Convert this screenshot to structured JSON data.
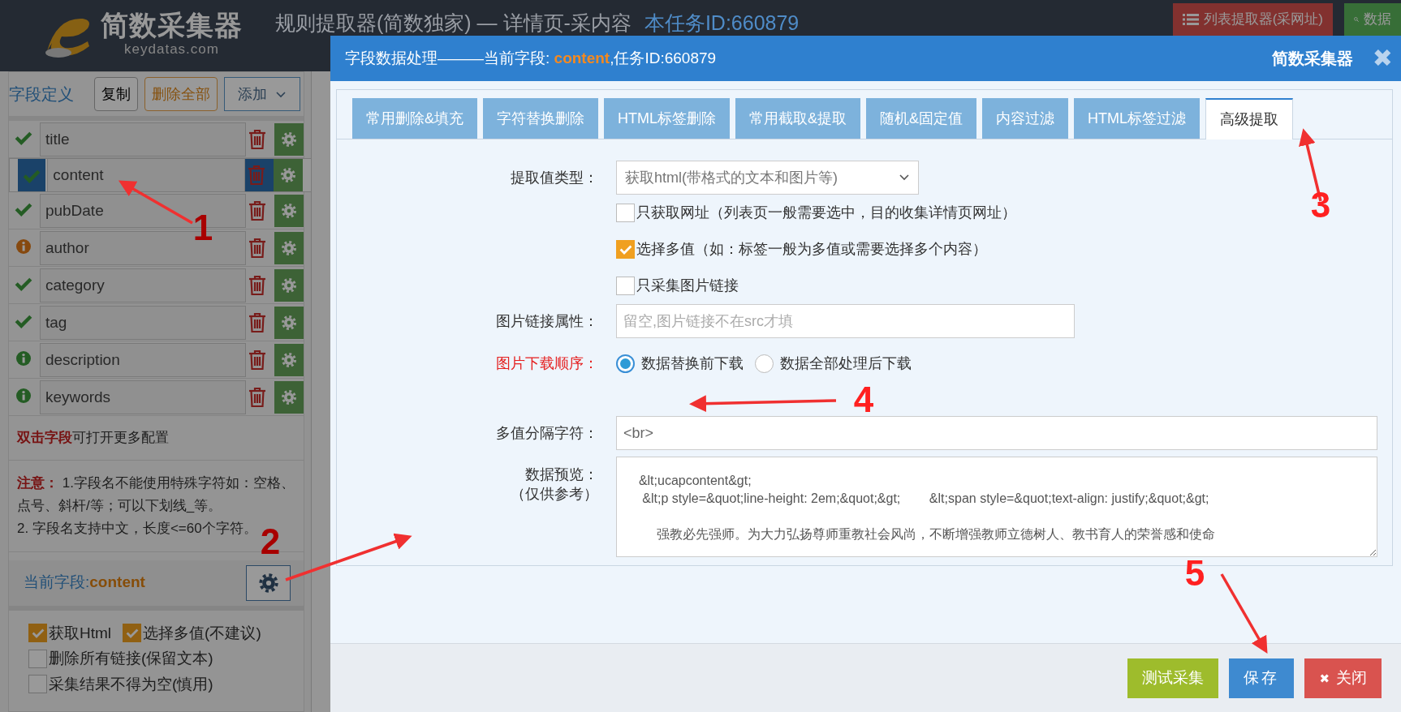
{
  "header": {
    "logo_text": "简数采集器",
    "logo_subtext": "keydatas.com",
    "title": "规则提取器(简数独家) — 详情页-采内容",
    "task_id": "本任务ID:660879",
    "buttons": [
      {
        "label": "列表提取器(采网址)",
        "kind": "list"
      },
      {
        "label": "数据",
        "kind": "preview"
      }
    ]
  },
  "fields_panel": {
    "title": "字段定义",
    "buttons": [
      {
        "label": "复制",
        "kind": "default"
      },
      {
        "label": "删除全部",
        "kind": "warning"
      },
      {
        "label": "添加",
        "kind": "dropdown"
      }
    ],
    "fields": [
      {
        "name": "title",
        "kind": "ok",
        "selected": false
      },
      {
        "name": "content",
        "kind": "ok",
        "selected": true
      },
      {
        "name": "pubDate",
        "kind": "ok",
        "selected": false
      },
      {
        "name": "author",
        "kind": "warning",
        "selected": false
      },
      {
        "name": "category",
        "kind": "ok",
        "selected": false
      },
      {
        "name": "tag",
        "kind": "ok",
        "selected": false
      },
      {
        "name": "description",
        "kind": "info",
        "selected": false
      },
      {
        "name": "keywords",
        "kind": "info",
        "selected": false
      }
    ],
    "hint": "**双击字段**可打开更多配置",
    "notes": [
      "**注意：** 1.字段名不能使用特殊字符如：空格、点号、斜杆/等；可以下划线_等。",
      "2. 字段名支持中文，长度<=60个字符。"
    ],
    "current_field": {
      "label": "当前字段:",
      "value": "content"
    },
    "options": [
      {
        "label": "获取Html",
        "checked": true
      },
      {
        "label": "选择多值(不建议)",
        "checked": true
      },
      {
        "label": "删除所有链接(保留文本)",
        "checked": false
      },
      {
        "label": "采集结果不得为空(慎用)",
        "checked": false
      }
    ]
  },
  "dialog": {
    "title": "字段数据处理———当前字段: **content**,任务ID:660879",
    "brand": "简数采集器",
    "close": "✖",
    "tabs": [
      {
        "label": "常用删除&填充",
        "selected": false
      },
      {
        "label": "字符替换删除",
        "selected": false
      },
      {
        "label": "HTML标签删除",
        "selected": false
      },
      {
        "label": "常用截取&提取",
        "selected": false
      },
      {
        "label": "随机&固定值",
        "selected": false
      },
      {
        "label": "内容过滤",
        "selected": false
      },
      {
        "label": "HTML标签过滤",
        "selected": false
      },
      {
        "label": "高级提取",
        "selected": true
      }
    ],
    "extract_type": {
      "label": "提取值类型：",
      "value": "获取html(带格式的文本和图片等)"
    },
    "checkboxes": [
      {
        "label": "只获取网址（列表页一般需要选中，目的收集详情页网址）",
        "checked": false
      },
      {
        "label": "选择多值（如：标签一般为多值或需要选择多个内容）",
        "checked": true
      },
      {
        "label": "只采集图片链接",
        "checked": false
      }
    ],
    "image_attr": {
      "label": "图片链接属性：",
      "placeholder": "留空,图片链接不在src才填"
    },
    "download_order": {
      "label": "图片下载顺序：",
      "options": [
        {
          "label": "数据替换前下载",
          "selected": true
        },
        {
          "label": "数据全部处理后下载",
          "selected": false
        }
      ]
    },
    "separator": {
      "label": "多值分隔字符：",
      "value": "<br>"
    },
    "preview": {
      "label": "数据预览：",
      "sublabel": "（仅供参考）",
      "lines": [
        "  &lt;ucapcontent&gt;",
        "   &lt;p style=&quot;line-height: 2em;&quot;&gt;        &lt;span style=&quot;text-align: justify;&quot;&gt;",
        "       强教必先强师。为大力弘扬尊师重教社会风尚，不断增强教师立德树人、教书育人的荣誉感和使命"
      ]
    },
    "footer_buttons": [
      {
        "label": "测试采集",
        "kind": "test"
      },
      {
        "label": "保存",
        "kind": "save"
      },
      {
        "label": "关闭",
        "kind": "close",
        "icon": "✖"
      }
    ]
  },
  "annotations": [
    {
      "label": "1"
    },
    {
      "label": "2"
    },
    {
      "label": "3"
    },
    {
      "label": "4"
    },
    {
      "label": "5"
    }
  ]
}
